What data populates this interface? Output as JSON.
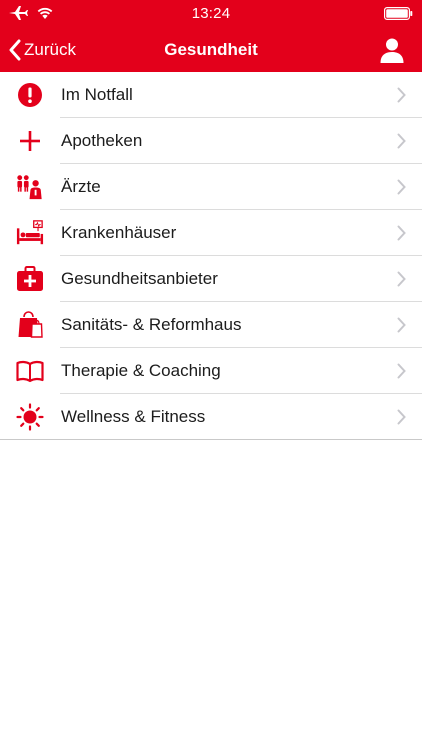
{
  "status_bar": {
    "time": "13:24",
    "icons": [
      "airplane-icon",
      "wifi-icon",
      "battery-icon"
    ]
  },
  "nav": {
    "back_label": "Zurück",
    "title": "Gesundheit",
    "right_icon": "user-icon"
  },
  "colors": {
    "accent": "#e3001b",
    "header_text": "#ffffff",
    "separator": "#dcdcdc",
    "chevron": "#c7c7cc"
  },
  "menu": {
    "items": [
      {
        "label": "Im Notfall",
        "icon": "alert-icon"
      },
      {
        "label": "Apotheken",
        "icon": "plus-icon"
      },
      {
        "label": "Ärzte",
        "icon": "doctors-icon"
      },
      {
        "label": "Krankenhäuser",
        "icon": "hospital-bed-icon"
      },
      {
        "label": "Gesundheitsanbieter",
        "icon": "medical-case-icon"
      },
      {
        "label": "Sanitäts- & Reformhaus",
        "icon": "shopping-bag-icon"
      },
      {
        "label": "Therapie & Coaching",
        "icon": "book-icon"
      },
      {
        "label": "Wellness & Fitness",
        "icon": "sun-icon"
      }
    ]
  }
}
